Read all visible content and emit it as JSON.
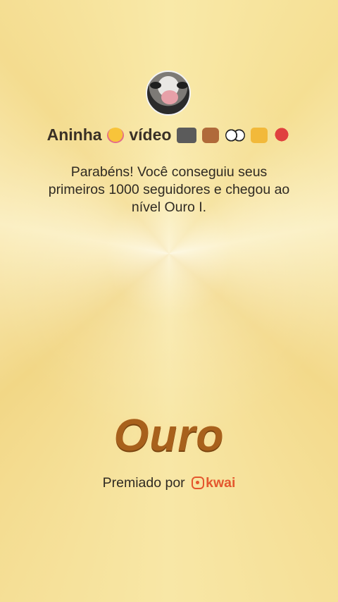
{
  "profile": {
    "username": "Aninha",
    "username_suffix": "vídeo",
    "emoji_icons": [
      "smiling-face-with-hearts",
      "video-camera",
      "dog",
      "eyes",
      "thumbs-up",
      "broken-heart"
    ]
  },
  "message": "Parabéns! Você conseguiu seus primeiros 1000 seguidores e chegou ao nível Ouro I.",
  "rank": {
    "title": "Ouro"
  },
  "award": {
    "prefix": "Premiado por",
    "brand": "kwai",
    "brand_color": "#e4572e"
  },
  "colors": {
    "background": "#f7e4a0",
    "rank_text": "#a8611c"
  }
}
